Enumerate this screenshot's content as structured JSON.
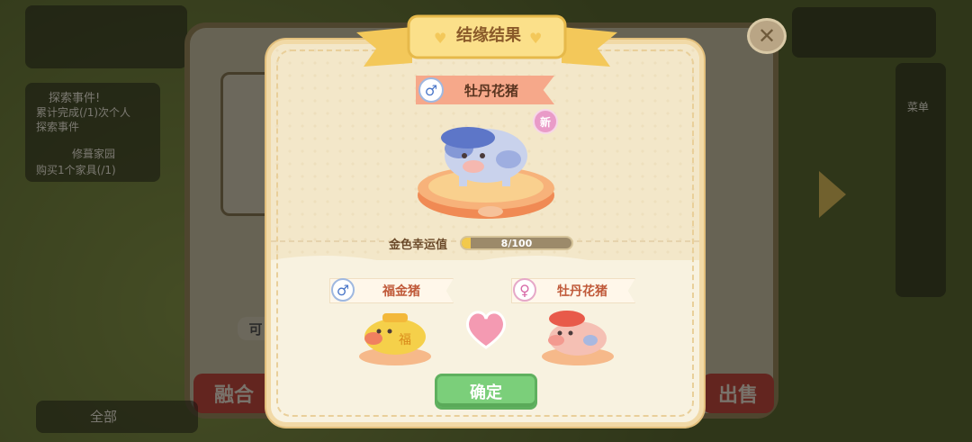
{
  "dialog": {
    "title": "结缘结果",
    "confirm_label": "确定",
    "new_badge": "新"
  },
  "result_pig": {
    "name": "牡丹花猪",
    "gender": "male"
  },
  "luck": {
    "label": "金色幸运值",
    "current": 8,
    "max": 100,
    "text": "8/100"
  },
  "parents": [
    {
      "name": "福金猪",
      "gender": "male"
    },
    {
      "name": "牡丹花猪",
      "gender": "female"
    }
  ],
  "background": {
    "left_button": "融合",
    "right_button": "出售",
    "badge_text": "可",
    "event_title": "探索事件!",
    "event_line1": "累计完成(/1)次个人",
    "event_line2": "探索事件",
    "task_title": "修葺家园",
    "task_line": "购买1个家具(/1)",
    "chat_all": "全部",
    "side_label": "菜单"
  },
  "colors": {
    "accent_pink": "#f6a88a",
    "confirm_green": "#7bcf7a",
    "luck_gold": "#f2c94c"
  }
}
